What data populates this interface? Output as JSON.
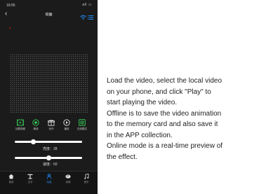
{
  "status": {
    "time": "16:55",
    "system_icons": "all ▭"
  },
  "nav": {
    "back_icon": "chevron-left",
    "title": "动画",
    "wifi_icon": "wifi-icon",
    "menu_icon": "menu-icon"
  },
  "controls": [
    {
      "label": "加载视频",
      "icon": "film-icon"
    },
    {
      "label": "离线",
      "icon": "record-icon"
    },
    {
      "label": "动作",
      "icon": "gift-icon"
    },
    {
      "label": "播放",
      "icon": "play-icon"
    },
    {
      "label": "在线模式",
      "icon": "online-mode-icon"
    }
  ],
  "brightness": {
    "label": "亮度：28",
    "value": 28
  },
  "speed": {
    "label": "速度：50",
    "value": 50
  },
  "tabs": [
    {
      "label": "首页",
      "icon": "home-icon"
    },
    {
      "label": "文字",
      "icon": "text-icon"
    },
    {
      "label": "动画",
      "icon": "animation-icon",
      "active": true
    },
    {
      "label": "涂鸦",
      "icon": "graffiti-icon"
    },
    {
      "label": "音乐",
      "icon": "music-icon"
    }
  ],
  "description": [
    "Load the video, select the local video",
    "on your phone, and click \"Play\" to",
    "start playing the video.",
    "Offline is to save the video animation",
    "to the memory card and also save it",
    "in the APP collection.",
    "Online mode is a real-time preview of",
    "the effect."
  ],
  "colors": {
    "accent_green": "#39d15a",
    "accent_blue": "#1e90ff",
    "background": "#1b1b1b"
  }
}
